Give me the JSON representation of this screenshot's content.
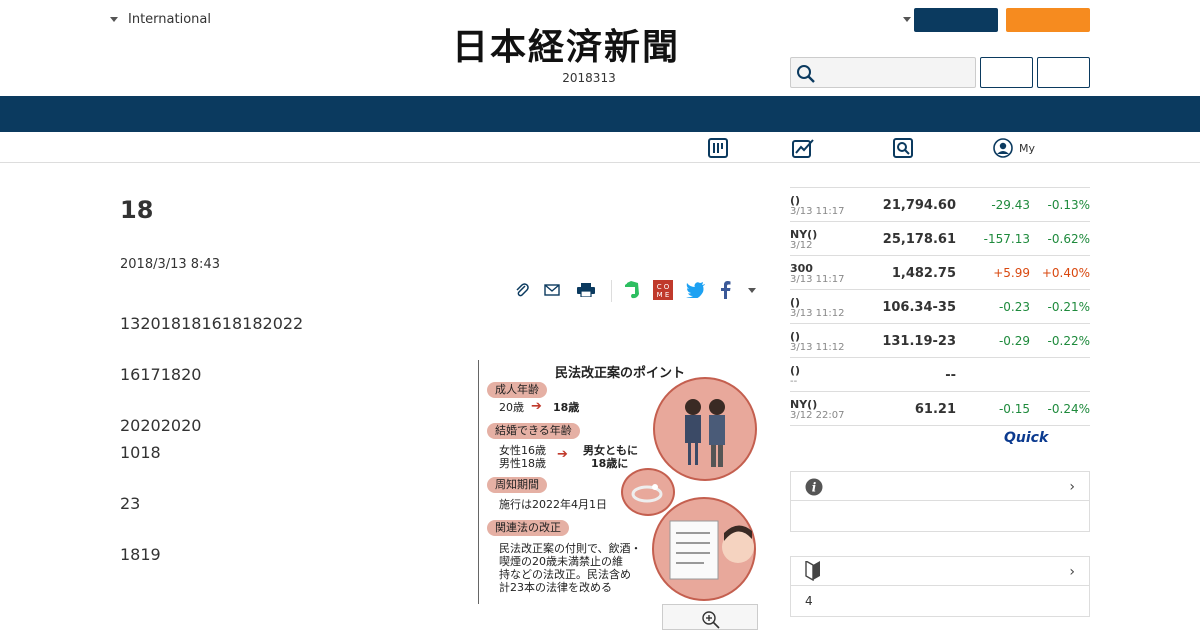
{
  "header": {
    "edition": "International",
    "logo": "日本経済新聞",
    "date": "2018313"
  },
  "subnav": {
    "my_label": "My"
  },
  "article": {
    "title": "18",
    "date": "2018/3/13 8:43",
    "paragraphs": [
      "132018181618182022",
      "16171820",
      "20202020",
      "1018",
      "23",
      "1819"
    ]
  },
  "figure": {
    "title": "民法改正案のポイント",
    "section1": "成人年齢",
    "s1_from": "20歳",
    "s1_to": "18歳",
    "section2": "結婚できる年齢",
    "s2_female": "女性16歳",
    "s2_male": "男性18歳",
    "s2_to_1": "男女ともに",
    "s2_to_2": "18歳に",
    "section3": "周知期間",
    "s3_text": "施行は2022年4月1日",
    "section4": "関連法の改正",
    "s4_line1": "民法改正案の付則で、飲酒・",
    "s4_line2": "喫煙の20歳未満禁止の維",
    "s4_line3": "持などの法改正。民法含め",
    "s4_line4": "計23本の法律を改める"
  },
  "market": {
    "rows": [
      {
        "name": "()",
        "time": "3/13 11:17",
        "value": "21,794.60",
        "change": "-29.43",
        "pct": "-0.13%",
        "dir": "down"
      },
      {
        "name": "NY()",
        "time": "3/12",
        "value": "25,178.61",
        "change": "-157.13",
        "pct": "-0.62%",
        "dir": "down"
      },
      {
        "name": "300",
        "time": "3/13 11:17",
        "value": "1,482.75",
        "change": "+5.99",
        "pct": "+0.40%",
        "dir": "up"
      },
      {
        "name": "()",
        "time": "3/13 11:12",
        "value": "106.34-35",
        "change": "-0.23",
        "pct": "-0.21%",
        "dir": "down"
      },
      {
        "name": "()",
        "time": "3/13 11:12",
        "value": "131.19-23",
        "change": "-0.29",
        "pct": "-0.22%",
        "dir": "down"
      },
      {
        "name": "()",
        "time": "--",
        "value": "--",
        "change": "",
        "pct": "",
        "dir": "down"
      },
      {
        "name": "NY()",
        "time": "3/12 22:07",
        "value": "61.21",
        "change": "-0.15",
        "pct": "-0.24%",
        "dir": "down"
      }
    ],
    "quick_logo": "Quick"
  },
  "boxes": {
    "box2_body": "4"
  },
  "colors": {
    "navy": "#0b3a5f",
    "orange": "#f68b1f",
    "down": "#1e8a3c",
    "up": "#d9480f"
  }
}
